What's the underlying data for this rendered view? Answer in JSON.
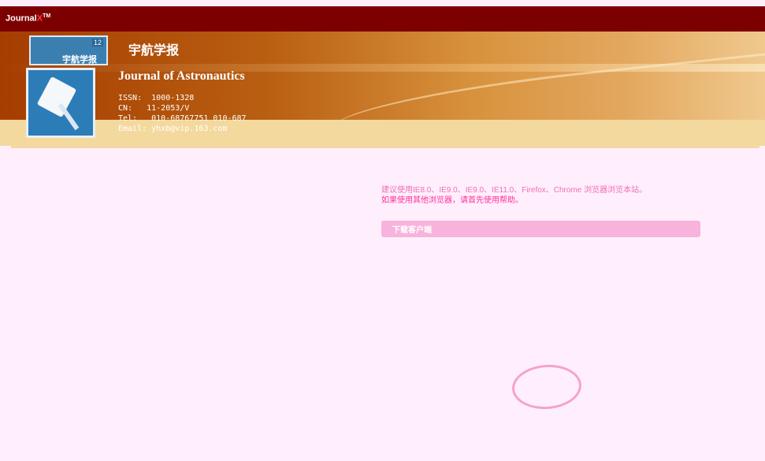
{
  "topbar": {
    "brand": "Journal",
    "brand_mark": "X",
    "brand_tm": "TM"
  },
  "banner": {
    "thumb_title": "宇航学报",
    "thumb_issue": "12",
    "title_cn": "宇航学报",
    "title_en": "Journal of Astronautics",
    "issn": "ISSN:  1000-1328",
    "cn": "CN:   11-2053/V",
    "tel": "Tel:   010-68767751 010-687",
    "email": "Email: yhxb@vip.163.com"
  },
  "notice": {
    "line1": "建议使用IE8.0、IE9.0、IE9.0、IE11.0、Firefox、Chrome 浏览器浏览本站。",
    "line3": "如果使用其他浏览器，请首先使用帮助。",
    "download_label": "下载客户端"
  },
  "colors": {
    "header": "#7d0000",
    "background": "#ffeffc",
    "accent_pink": "#ff2f9a",
    "button": "#f8b3dc",
    "highlight_circle": "#f4a3c9"
  }
}
